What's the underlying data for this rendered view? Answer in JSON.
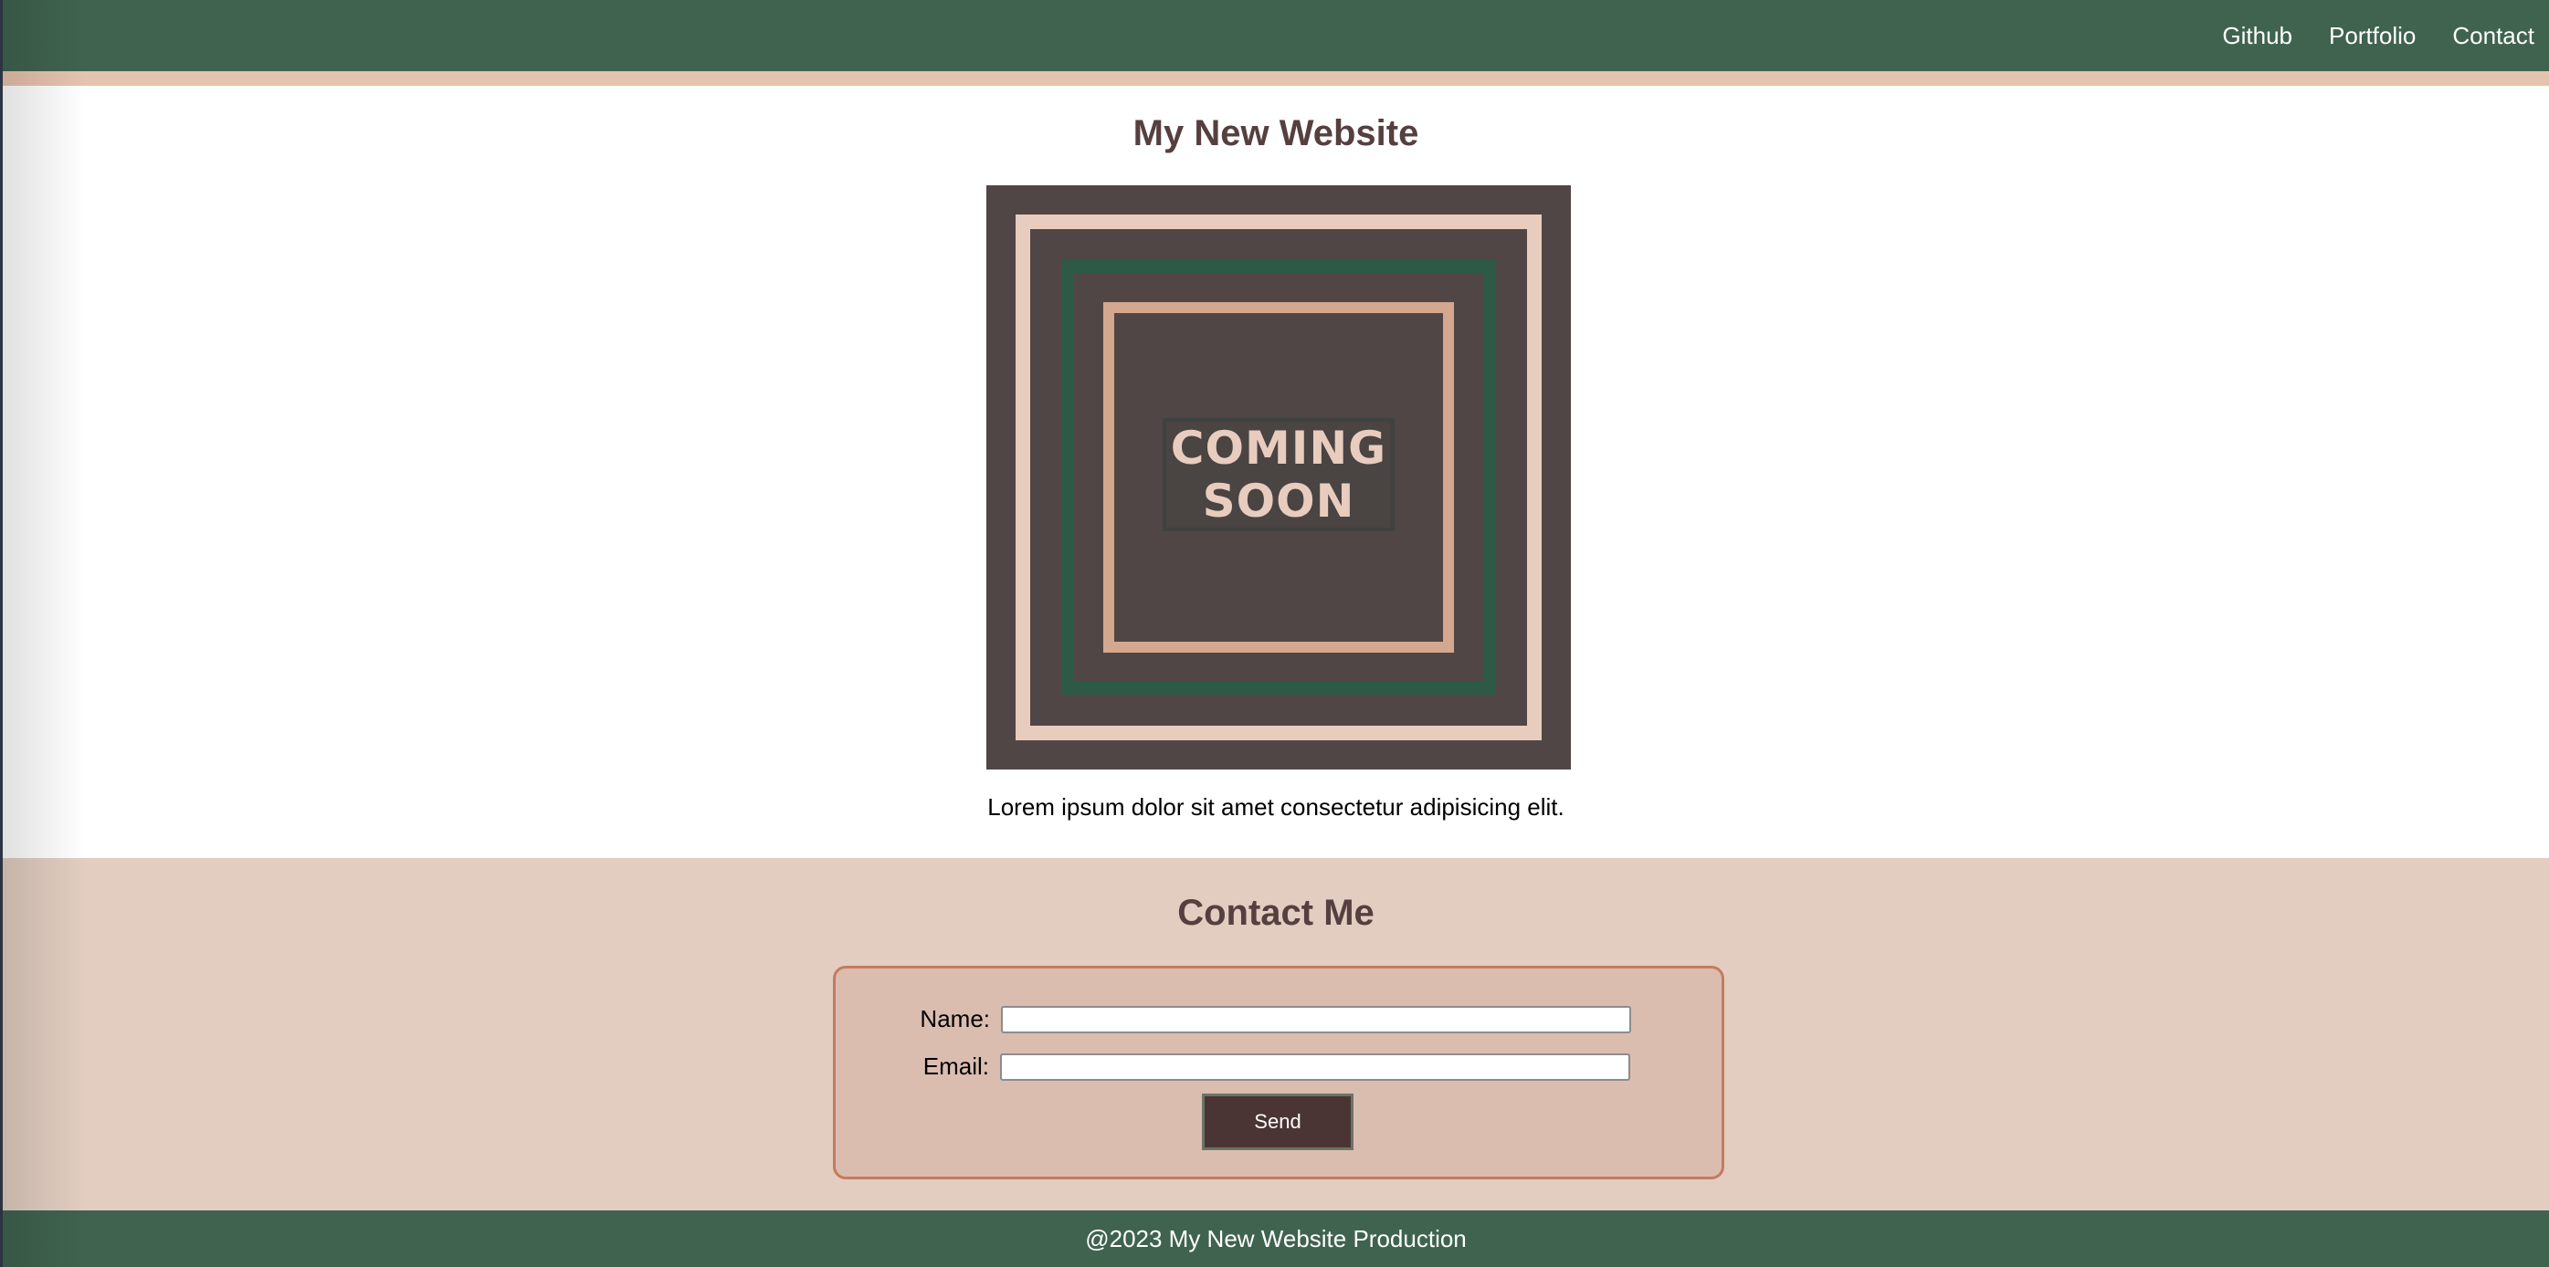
{
  "nav": {
    "links": [
      "Github",
      "Portfolio",
      "Contact"
    ]
  },
  "main": {
    "title": "My New Website",
    "image": {
      "line1": "COMING",
      "line2": "SOON"
    },
    "description": "Lorem ipsum dolor sit amet consectetur adipisicing elit."
  },
  "contact": {
    "title": "Contact Me",
    "name_label": "Name:",
    "name_value": "",
    "email_label": "Email:",
    "email_value": "",
    "send_label": "Send"
  },
  "footer": {
    "text": "@2023 My New Website Production"
  },
  "colors": {
    "nav_bg": "#3f634f",
    "accent_stripe": "#e6c3ae",
    "heading": "#563f3f",
    "contact_bg": "#e2cdc0",
    "form_bg": "#dbbdb0",
    "form_border": "#c47c5c",
    "button_bg": "#4a3534"
  }
}
